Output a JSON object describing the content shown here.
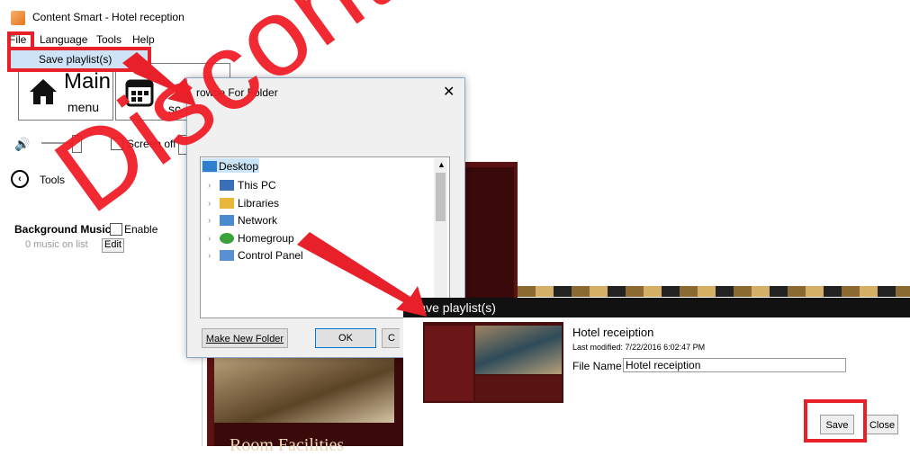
{
  "window": {
    "title": "Content Smart - Hotel reception"
  },
  "menu": {
    "items": [
      "File",
      "Language",
      "Tools",
      "Help"
    ],
    "file_dropdown_item": "Save playlist(s)"
  },
  "main_buttons": {
    "main_line1": "Main",
    "main_line2": "menu",
    "schedule_partial": "sc"
  },
  "controls": {
    "screen_off": "Screen off"
  },
  "tools": {
    "label": "Tools"
  },
  "background_music": {
    "label": "Background Music",
    "enable": "Enable",
    "count": "0  music on list",
    "edit": "Edit"
  },
  "preview": {
    "caption": "Room Facilities"
  },
  "browse_dialog": {
    "title": "rowse For Folder",
    "tree": [
      "Desktop",
      "This PC",
      "Libraries",
      "Network",
      "Homegroup",
      "Control Panel"
    ],
    "make_new_folder": "Make New Folder",
    "ok": "OK"
  },
  "save_dialog": {
    "title": "Save playlist(s)",
    "playlist_name": "Hotel receiption",
    "last_modified": "Last modified: 7/22/2016 6:02:47 PM",
    "file_name_label": "File Name",
    "file_name_value": "Hotel receiption",
    "save": "Save",
    "close": "Close"
  },
  "overlay": {
    "watermark": "Discontinued",
    "accent_color": "#e8202a"
  }
}
